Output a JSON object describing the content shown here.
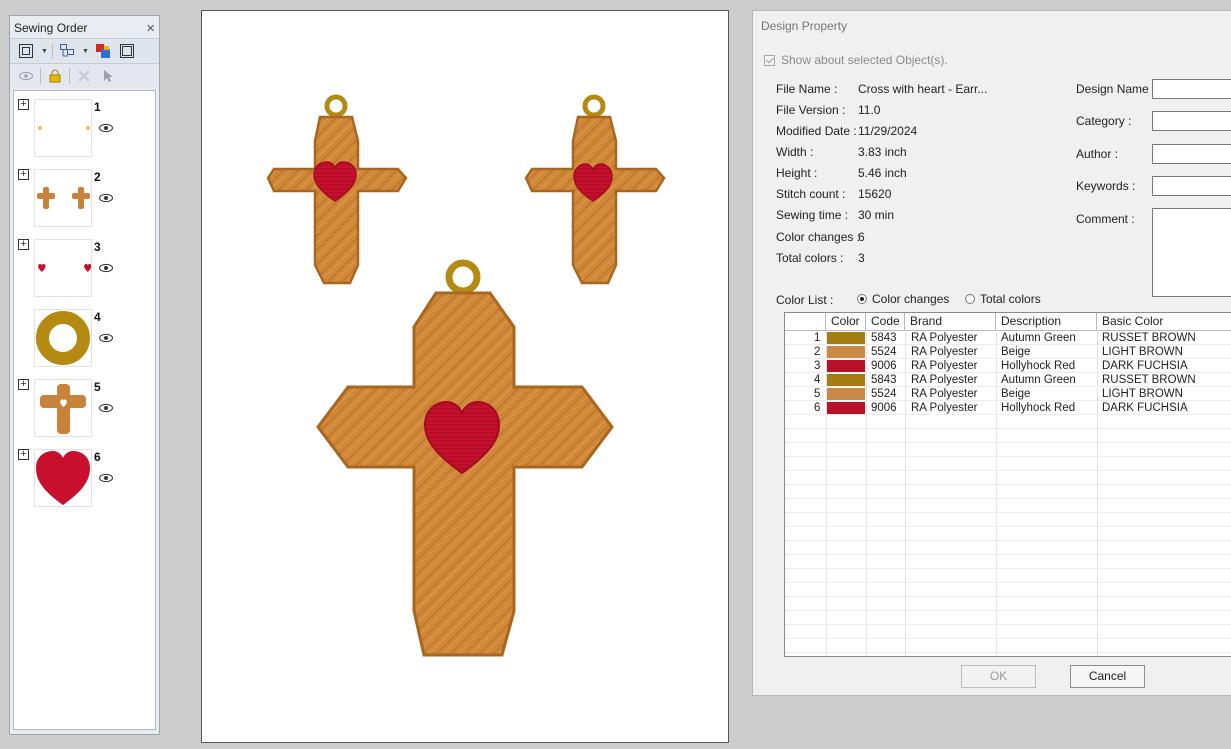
{
  "sewing_order": {
    "title": "Sewing Order",
    "close": "×",
    "items": [
      {
        "num": "1",
        "expandable": true
      },
      {
        "num": "2",
        "expandable": true
      },
      {
        "num": "3",
        "expandable": true
      },
      {
        "num": "4",
        "expandable": false
      },
      {
        "num": "5",
        "expandable": true
      },
      {
        "num": "6",
        "expandable": true
      }
    ],
    "expand_glyph": "+"
  },
  "dialog": {
    "title": "Design Property",
    "show_about": "Show about selected Object(s).",
    "info": [
      {
        "label": "File Name :",
        "value": "Cross with heart - Earr..."
      },
      {
        "label": "File Version :",
        "value": "11.0"
      },
      {
        "label": "Modified Date :",
        "value": "11/29/2024"
      },
      {
        "label": "Width :",
        "value": "3.83 inch"
      },
      {
        "label": "Height :",
        "value": "5.46 inch"
      },
      {
        "label": "Stitch count :",
        "value": "15620"
      },
      {
        "label": "Sewing time :",
        "value": "30 min"
      },
      {
        "label": "Color changes :",
        "value": "6"
      },
      {
        "label": "Total colors :",
        "value": "3"
      }
    ],
    "fields": {
      "design_name": "Design Name :",
      "category": "Category :",
      "author": "Author :",
      "keywords": "Keywords :",
      "comment": "Comment :"
    },
    "color_list_label": "Color List :",
    "radio_changes": "Color changes",
    "radio_total": "Total colors",
    "columns": [
      "Color",
      "Code",
      "Brand",
      "Description",
      "Basic Color"
    ],
    "rows": [
      {
        "n": "1",
        "color": "#a57c12",
        "code": "5843",
        "brand": "RA Polyester",
        "desc": "Autumn Green",
        "basic": "RUSSET BROWN"
      },
      {
        "n": "2",
        "color": "#c88a46",
        "code": "5524",
        "brand": "RA Polyester",
        "desc": "Beige",
        "basic": "LIGHT BROWN"
      },
      {
        "n": "3",
        "color": "#b8122b",
        "code": "9006",
        "brand": "RA Polyester",
        "desc": "Hollyhock Red",
        "basic": "DARK FUCHSIA"
      },
      {
        "n": "4",
        "color": "#a57c12",
        "code": "5843",
        "brand": "RA Polyester",
        "desc": "Autumn Green",
        "basic": "RUSSET BROWN"
      },
      {
        "n": "5",
        "color": "#c88a46",
        "code": "5524",
        "brand": "RA Polyester",
        "desc": "Beige",
        "basic": "LIGHT BROWN"
      },
      {
        "n": "6",
        "color": "#b8122b",
        "code": "9006",
        "brand": "RA Polyester",
        "desc": "Hollyhock Red",
        "basic": "DARK FUCHSIA"
      }
    ],
    "ok": "OK",
    "cancel": "Cancel"
  },
  "colors": {
    "ring": "#b48a12",
    "cross": "#cf8738",
    "cross_dark": "#a9661e",
    "heart": "#c8102e"
  }
}
